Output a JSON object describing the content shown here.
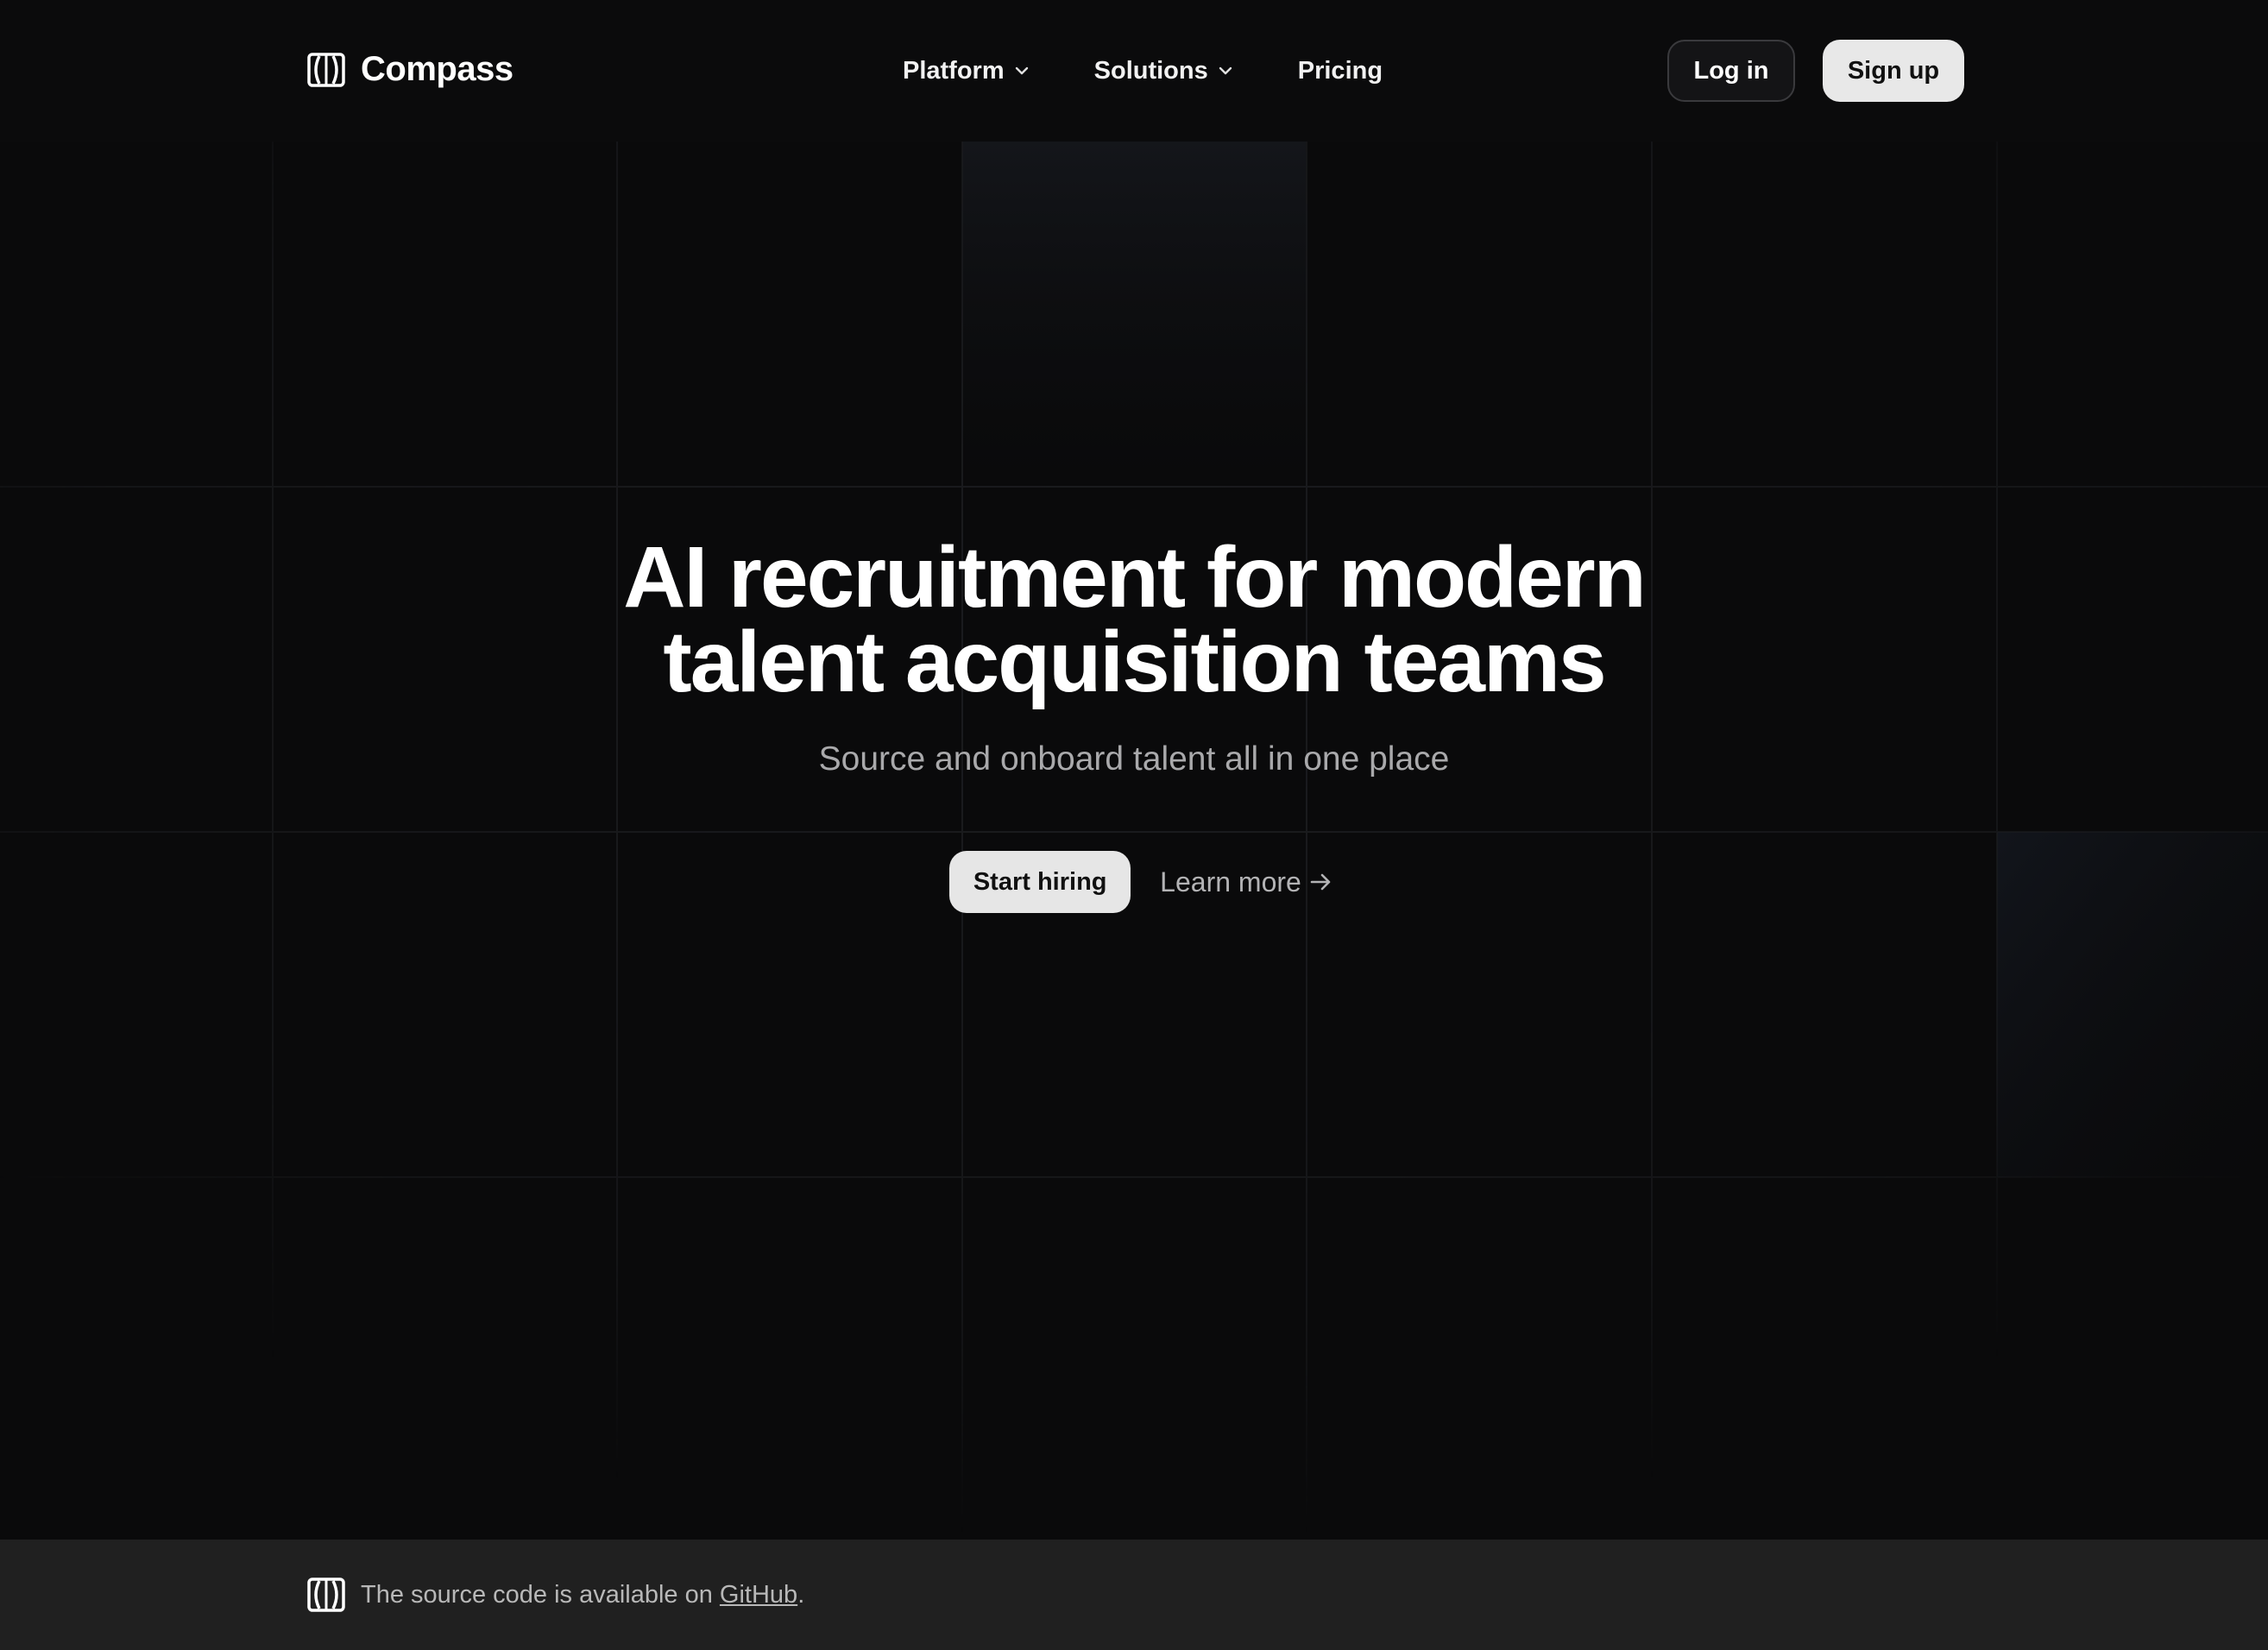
{
  "brand": {
    "name": "Compass",
    "logo_icon": "compass-logo-icon"
  },
  "nav": {
    "items": [
      {
        "label": "Platform",
        "has_dropdown": true
      },
      {
        "label": "Solutions",
        "has_dropdown": true
      },
      {
        "label": "Pricing",
        "has_dropdown": false
      }
    ]
  },
  "auth": {
    "login_label": "Log in",
    "signup_label": "Sign up"
  },
  "hero": {
    "title_line1": "AI recruitment for modern",
    "title_line2": "talent acquisition teams",
    "subtitle": "Source and onboard talent all in one place",
    "primary_cta": "Start hiring",
    "secondary_cta": "Learn more",
    "secondary_cta_icon": "arrow-right-icon"
  },
  "footer": {
    "text_before": "The source code is available on ",
    "link_label": "GitHub",
    "text_after": "."
  },
  "colors": {
    "background": "#0a0a0b",
    "footer_background": "#202020",
    "primary_button": "#e6e6e6",
    "subtitle": "#a9a9ab",
    "grid_line": "#1b1c1f"
  }
}
